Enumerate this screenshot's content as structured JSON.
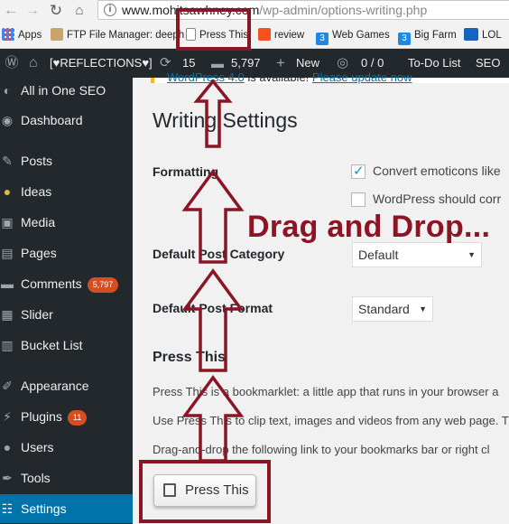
{
  "browser": {
    "back_icon": "arrow-left",
    "forward_icon": "arrow-right",
    "reload_icon": "reload",
    "url_host": "www.mohitsawhney.com",
    "url_path": "/wp-admin/options-writing.php"
  },
  "bookmarks": [
    {
      "label": "Apps",
      "icon": "apps-grid",
      "color": "#4285f4"
    },
    {
      "label": "FTP File Manager: deeph",
      "icon": "ftp-icon",
      "color": "#8a6d3b"
    },
    {
      "label": "Press This",
      "icon": "page-icon",
      "color": "#ffffff"
    },
    {
      "label": "review",
      "icon": "review-icon",
      "color": "#f4511e"
    },
    {
      "label": "Web Games",
      "icon": "three-icon",
      "color": "#1e88e5"
    },
    {
      "label": "Big Farm",
      "icon": "three-icon",
      "color": "#1e88e5"
    },
    {
      "label": "LOL",
      "icon": "lol-icon",
      "color": "#1565c0"
    }
  ],
  "adminbar": {
    "site_name": "[♥REFLECTIONS♥]",
    "updates_count": "15",
    "comments_count": "5,797",
    "new_label": "New",
    "seo_count": "0 / 0",
    "todo_label": "To-Do List",
    "seo_label": "SEO"
  },
  "sidebar": {
    "items": [
      {
        "label": "All in One SEO",
        "icon": "seo-icon"
      },
      {
        "label": "Dashboard",
        "icon": "dashboard-icon"
      },
      {
        "label": "Posts",
        "icon": "pin-icon"
      },
      {
        "label": "Ideas",
        "icon": "bulb-icon"
      },
      {
        "label": "Media",
        "icon": "media-icon"
      },
      {
        "label": "Pages",
        "icon": "page-icon"
      },
      {
        "label": "Comments",
        "icon": "comment-icon",
        "badge": "5,797"
      },
      {
        "label": "Slider",
        "icon": "slider-icon"
      },
      {
        "label": "Bucket List",
        "icon": "list-icon"
      },
      {
        "label": "Appearance",
        "icon": "brush-icon"
      },
      {
        "label": "Plugins",
        "icon": "plug-icon",
        "badge": "11"
      },
      {
        "label": "Users",
        "icon": "user-icon"
      },
      {
        "label": "Tools",
        "icon": "wrench-icon"
      },
      {
        "label": "Settings",
        "icon": "settings-icon",
        "active": true
      }
    ]
  },
  "notice": {
    "text_a": "WordPress 4.0",
    "text_b": " is available! ",
    "link": "Please update now"
  },
  "main": {
    "title": "Writing Settings",
    "formatting_label": "Formatting",
    "opt_emoticons": "Convert emoticons like",
    "opt_correct": "WordPress should corr",
    "default_category_label": "Default Post Category",
    "default_category_value": "Default",
    "default_format_label": "Default Post Format",
    "default_format_value": "Standard",
    "press_this_heading": "Press This",
    "press_this_p1": "Press This is a bookmarklet: a little app that runs in your browser a",
    "press_this_p2": "Use Press This to clip text, images and videos from any web page. T",
    "press_this_p3": "Drag-and-drop the following link to your bookmarks bar or right cl",
    "press_this_button": "Press This"
  },
  "annotation": {
    "text": "Drag and Drop...",
    "color": "#8b1525"
  }
}
